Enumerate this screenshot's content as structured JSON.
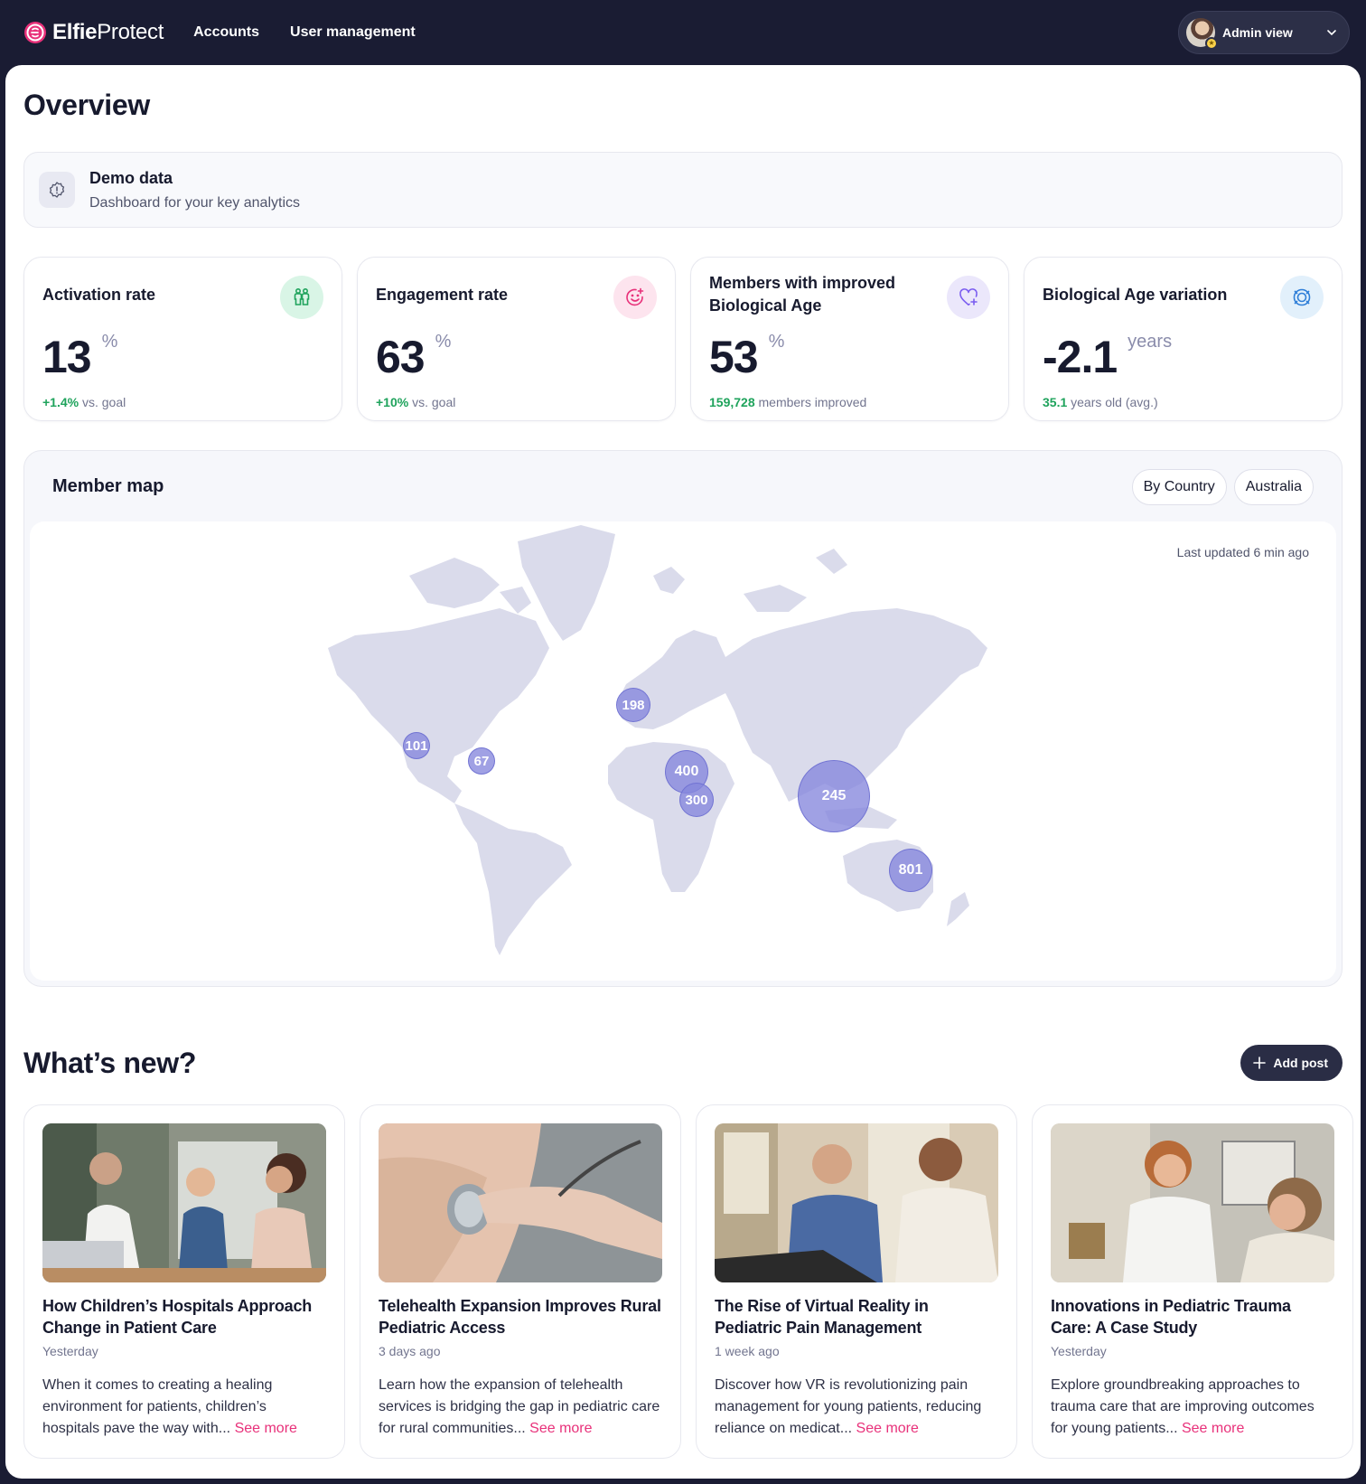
{
  "nav": {
    "brand_bold": "Elfie",
    "brand_light": "Protect",
    "links": [
      "Accounts",
      "User management"
    ],
    "admin_label": "Admin view"
  },
  "page": {
    "title": "Overview"
  },
  "demo": {
    "title": "Demo data",
    "subtitle": "Dashboard for your key analytics"
  },
  "stats": [
    {
      "label": "Activation rate",
      "value": "13",
      "unit": "%",
      "foot_highlight": "+1.4%",
      "foot_text": " vs. goal",
      "icon": "people-icon",
      "icon_bg": "#d9f5e6",
      "icon_color": "#1fa35c"
    },
    {
      "label": "Engagement rate",
      "value": "63",
      "unit": "%",
      "foot_highlight": "+10%",
      "foot_text": " vs. goal",
      "icon": "smile-plus-icon",
      "icon_bg": "#fde4ee",
      "icon_color": "#e8317a"
    },
    {
      "label": "Members with improved Biological Age",
      "value": "53",
      "unit": "%",
      "foot_highlight": "159,728",
      "foot_text": " members improved",
      "icon": "heart-plus-icon",
      "icon_bg": "#ebe7fb",
      "icon_color": "#7a5cf0"
    },
    {
      "label": "Biological Age variation",
      "value": "-2.1",
      "unit": "years",
      "foot_highlight": "35.1",
      "foot_text": " years old (avg.)",
      "icon": "target-icon",
      "icon_bg": "#e2f0fb",
      "icon_color": "#2f7fd8"
    }
  ],
  "map": {
    "title": "Member map",
    "filters": [
      "By Country",
      "Australia"
    ],
    "updated": "Last updated 6 min ago",
    "clusters": [
      {
        "label": "198",
        "size": "m"
      },
      {
        "label": "101",
        "size": "s"
      },
      {
        "label": "67",
        "size": "s"
      },
      {
        "label": "400",
        "size": "l"
      },
      {
        "label": "300",
        "size": "m"
      },
      {
        "label": "245",
        "size": "xl"
      },
      {
        "label": "801",
        "size": "l"
      }
    ]
  },
  "news": {
    "title": "What’s new?",
    "add_label": "Add post",
    "see_more": "See more",
    "posts": [
      {
        "title": "How Children’s Hospitals Approach Change in Patient Care",
        "date": "Yesterday",
        "body": "When it comes to creating a healing environment for patients, children’s hospitals pave the way with... "
      },
      {
        "title": "Telehealth Expansion Improves Rural Pediatric Access",
        "date": "3 days ago",
        "body": "Learn how the expansion of telehealth services is bridging the gap in pediatric care for rural communities... "
      },
      {
        "title": "The Rise of Virtual Reality in Pediatric Pain Management",
        "date": "1 week ago",
        "body": "Discover how VR is revolutionizing pain management for young patients, reducing reliance on medicat... "
      },
      {
        "title": "Innovations in Pediatric Trauma Care: A Case Study",
        "date": "Yesterday",
        "body": "Explore groundbreaking approaches to trauma care that are improving outcomes for young patients... "
      }
    ]
  }
}
